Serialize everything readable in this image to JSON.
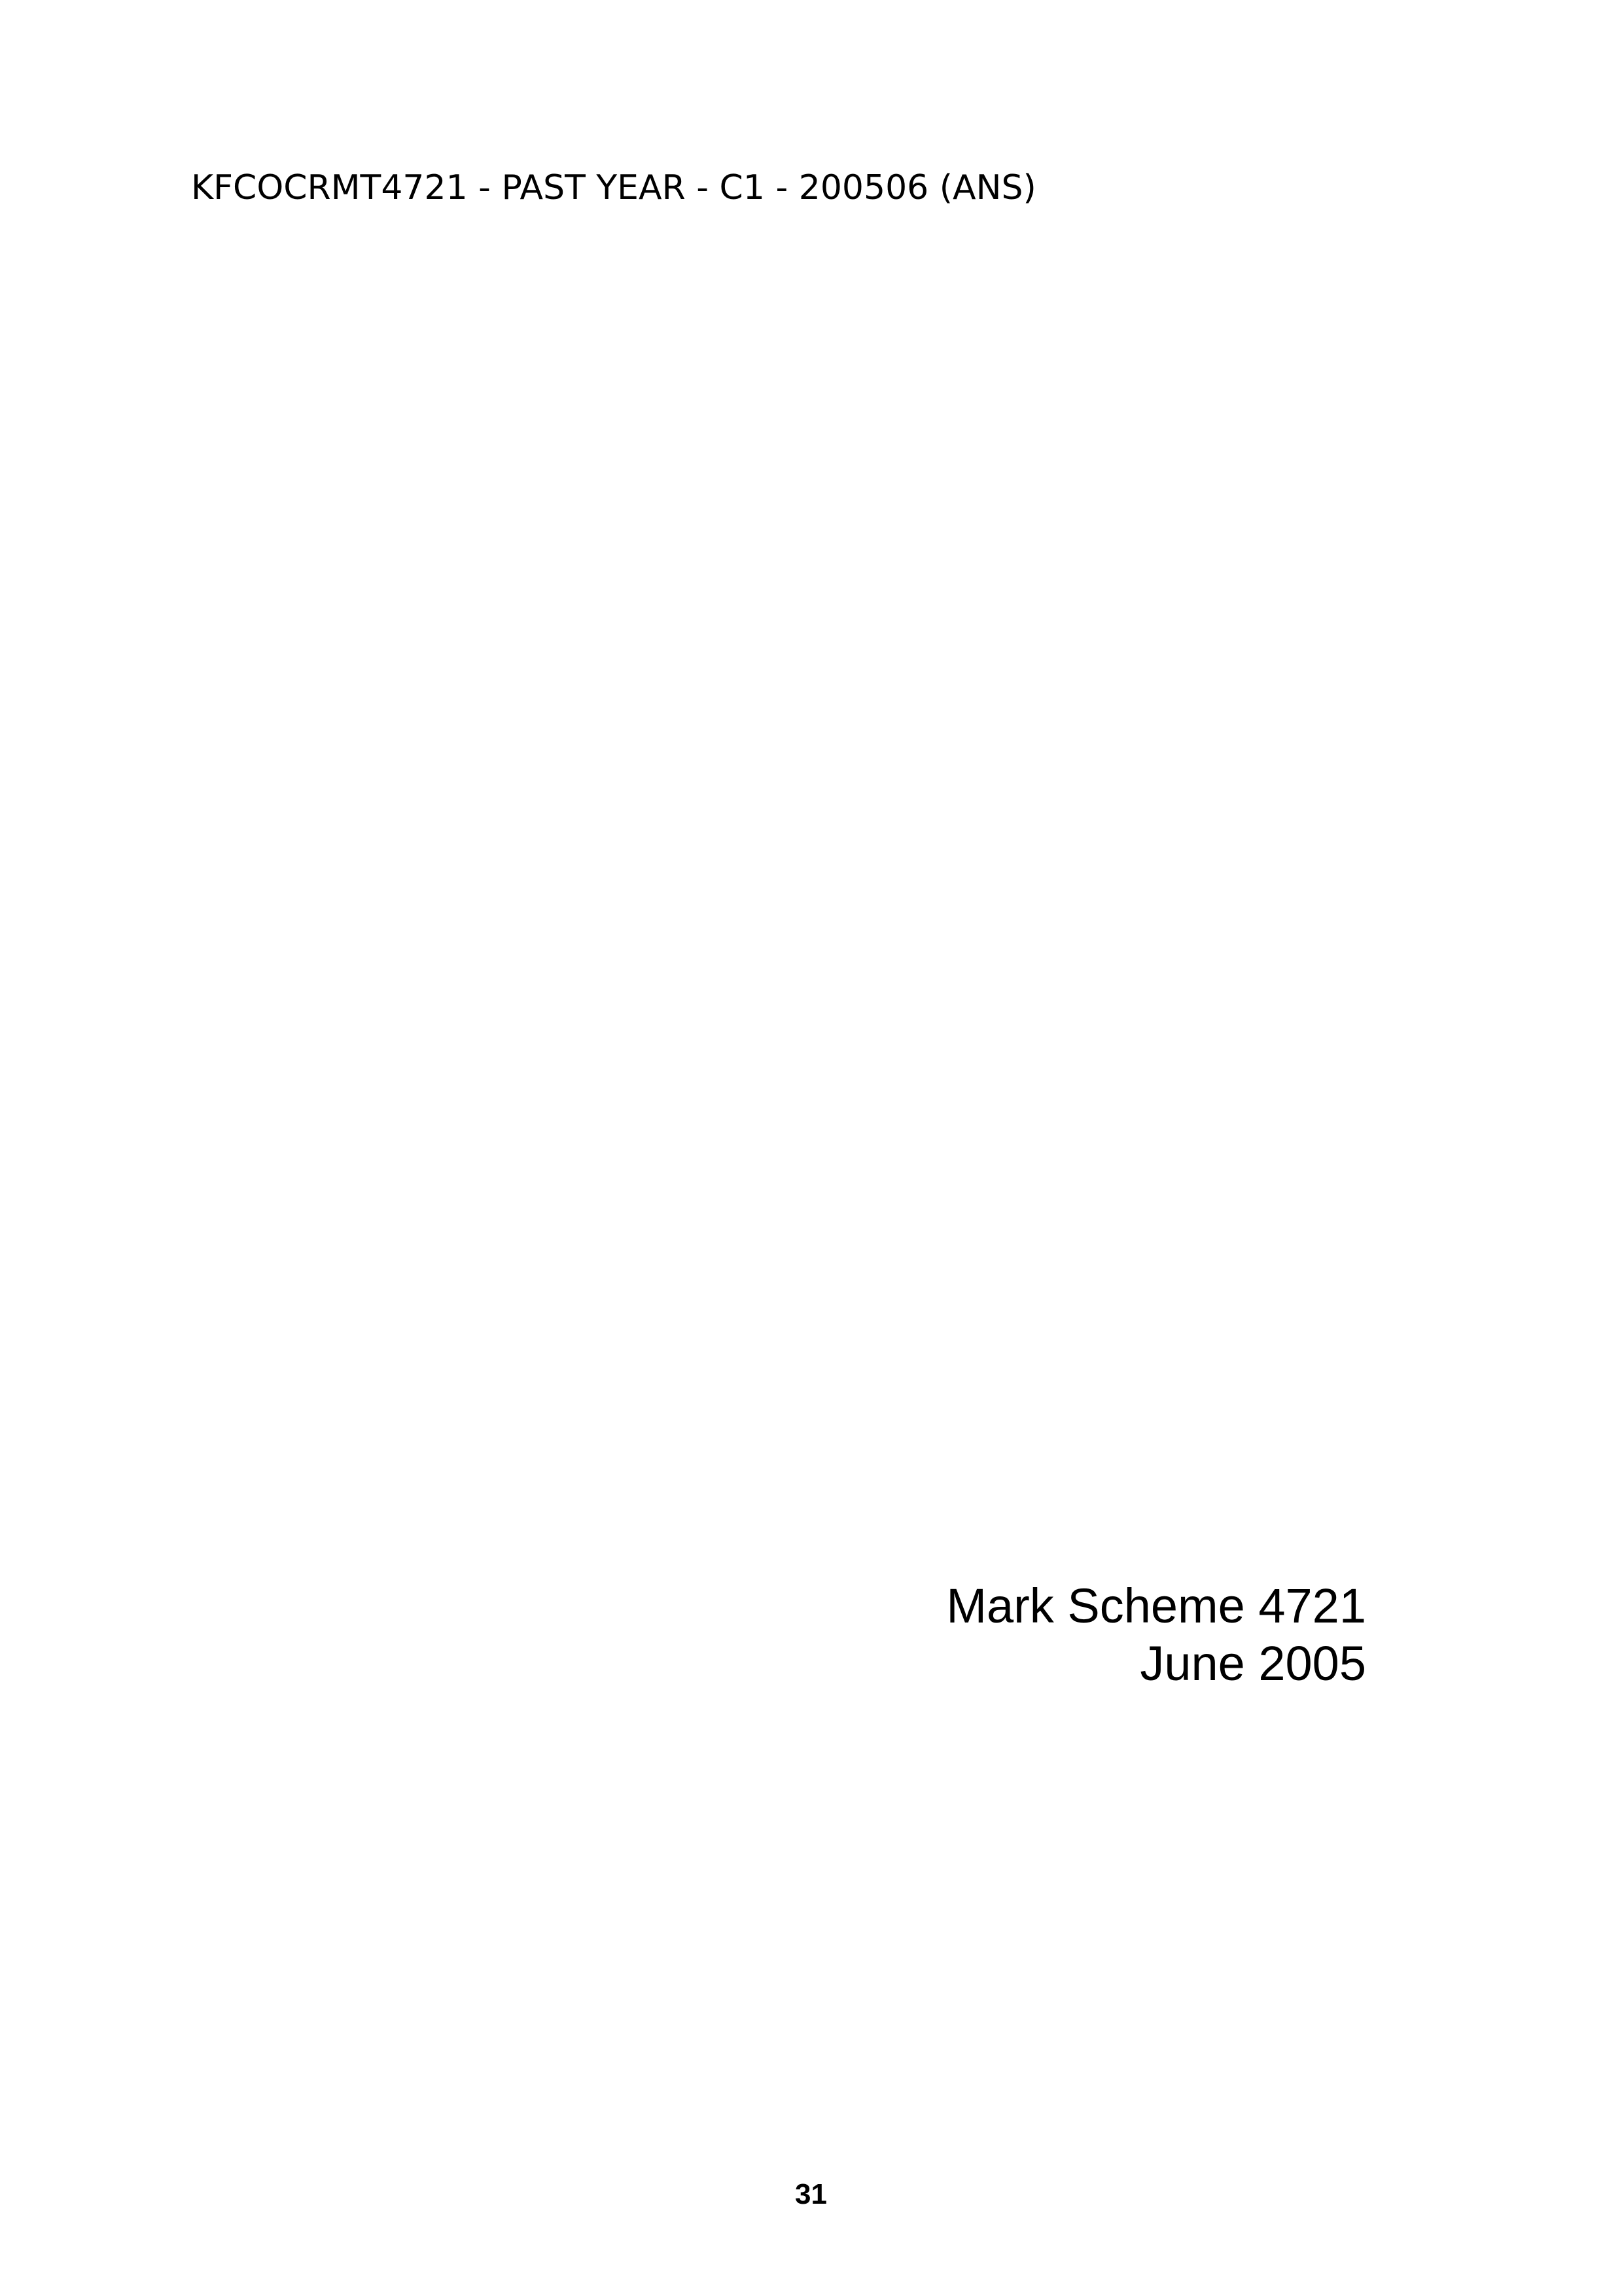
{
  "header": {
    "text": "KFCOCRMT4721 - PAST YEAR - C1 - 200506 (ANS)"
  },
  "title_block": {
    "line1": "Mark Scheme 4721",
    "line2": "June 2005"
  },
  "footer": {
    "page_number": "31"
  }
}
